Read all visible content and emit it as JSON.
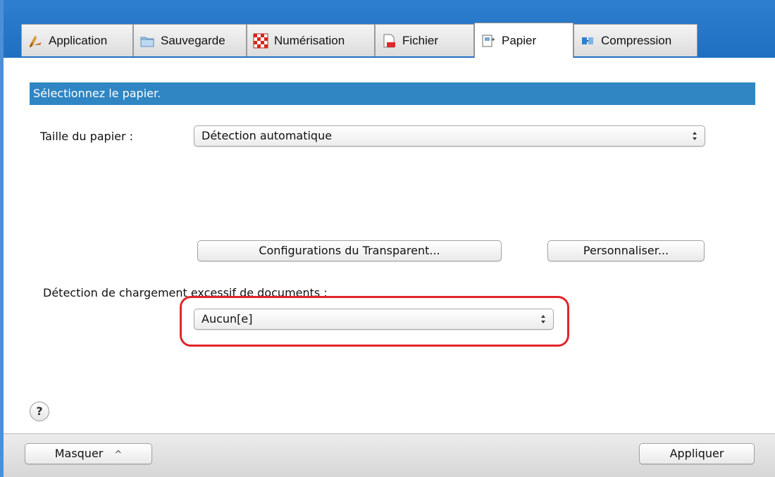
{
  "tabs": [
    {
      "label": "Application",
      "icon": "application-icon",
      "active": false
    },
    {
      "label": "Sauvegarde",
      "icon": "folder-icon",
      "active": false
    },
    {
      "label": "Numérisation",
      "icon": "scan-checker-icon",
      "active": false
    },
    {
      "label": "Fichier",
      "icon": "file-icon",
      "active": false
    },
    {
      "label": "Papier",
      "icon": "paper-icon",
      "active": true
    },
    {
      "label": "Compression",
      "icon": "compression-icon",
      "active": false
    }
  ],
  "panel": {
    "header": "Sélectionnez le papier.",
    "paper_size_label": "Taille du papier :",
    "paper_size_value": "Détection automatique",
    "transparent_button": "Configurations du Transparent...",
    "customize_button": "Personnaliser...",
    "overload_label": "Détection de chargement excessif de documents :",
    "overload_value": "Aucun[e]",
    "help": "?"
  },
  "bottom": {
    "hide_button": "Masquer",
    "hide_chevron": "^",
    "apply_button": "Appliquer"
  },
  "colors": {
    "header_bg": "#2f86c3",
    "tabstrip_bg": "#2f7fd0",
    "highlight_border": "#e0262b"
  }
}
